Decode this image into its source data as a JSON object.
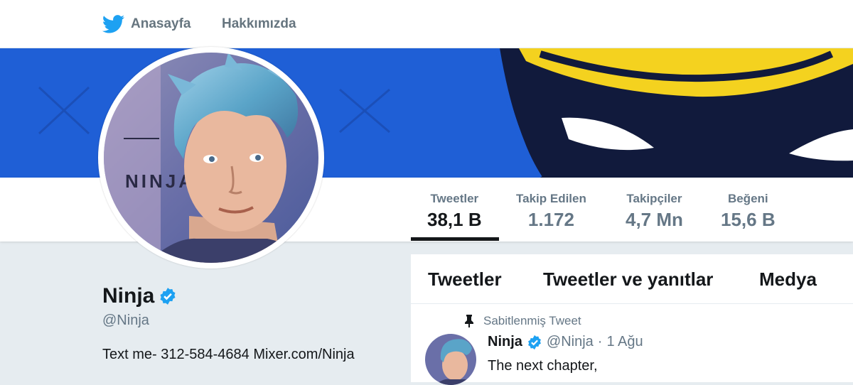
{
  "nav": {
    "home_label": "Anasayfa",
    "about_label": "Hakkımızda",
    "home_icon": "twitter-bird-icon"
  },
  "colors": {
    "brand_blue": "#1da1f2",
    "banner_blue": "#1f5fd6",
    "banner_navy": "#111a3c",
    "banner_yellow": "#f4d21f",
    "verified_blue": "#1da1f2"
  },
  "stats": [
    {
      "label": "Tweetler",
      "value": "38,1 B",
      "active": true
    },
    {
      "label": "Takip Edilen",
      "value": "1.172",
      "active": false
    },
    {
      "label": "Takipçiler",
      "value": "4,7 Mn",
      "active": false
    },
    {
      "label": "Beğeni",
      "value": "15,6 B",
      "active": false
    }
  ],
  "profile": {
    "name": "Ninja",
    "handle": "@Ninja",
    "bio": "Text me- 312-584-4684 Mixer.com/Ninja",
    "verified_icon": "verified-badge-icon"
  },
  "timeline": {
    "tabs": [
      "Tweetler",
      "Tweetler ve yanıtlar",
      "Medya"
    ],
    "pinned_label": "Sabitlenmiş Tweet",
    "pin_icon": "pin-icon",
    "tweet": {
      "name": "Ninja",
      "handle": "@Ninja",
      "separator": "·",
      "date": "1 Ağu",
      "text": "The next chapter,"
    }
  }
}
